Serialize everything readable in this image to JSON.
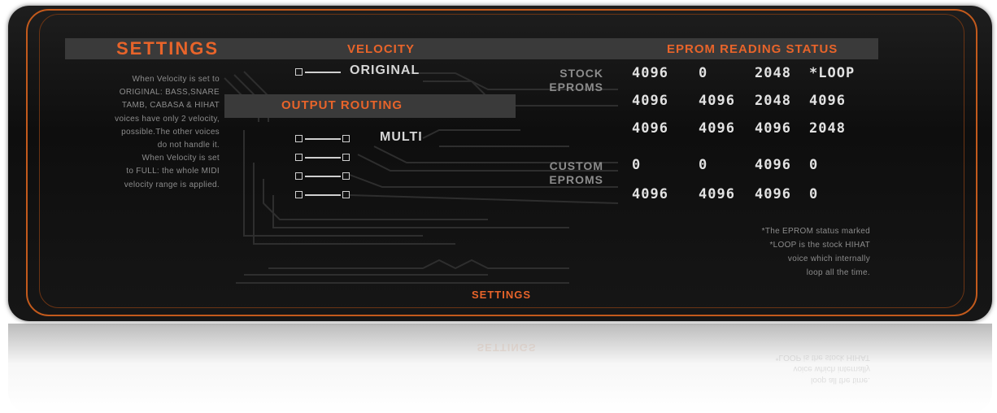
{
  "headers": {
    "settings": "SETTINGS",
    "velocity": "VELOCITY",
    "eprom_status": "EPROM READING STATUS",
    "output_routing": "OUTPUT ROUTING"
  },
  "description_lines": [
    "When Velocity is set to",
    "ORIGINAL: BASS,SNARE",
    "TAMB, CABASA & HIHAT",
    "voices have only 2 velocity,",
    "possible.The other voices",
    "do not handle it.",
    "When Velocity is set",
    "to FULL: the whole MIDI",
    "velocity range is applied."
  ],
  "velocity": {
    "selected": "ORIGINAL"
  },
  "output_routing": {
    "selected": "MULTI"
  },
  "stock_eproms": {
    "label_lines": [
      "STOCK",
      "EPROMS"
    ],
    "rows": [
      [
        "4096",
        "0",
        "2048",
        "*LOOP"
      ],
      [
        "4096",
        "4096",
        "2048",
        "4096"
      ],
      [
        "4096",
        "4096",
        "4096",
        "2048"
      ]
    ]
  },
  "custom_eproms": {
    "label_lines": [
      "CUSTOM",
      "EPROMS"
    ],
    "rows": [
      [
        "0",
        "0",
        "4096",
        "0"
      ],
      [
        "4096",
        "4096",
        "4096",
        "0"
      ]
    ]
  },
  "note_lines": [
    "*The EPROM status marked",
    "*LOOP is the stock HIHAT",
    "voice which internally",
    "loop all the time."
  ],
  "footer_tab": "SETTINGS",
  "colors": {
    "accent": "#e8642a",
    "bezel": "#c35a1c",
    "panel": "#141414",
    "bar": "#3a3a3a"
  }
}
